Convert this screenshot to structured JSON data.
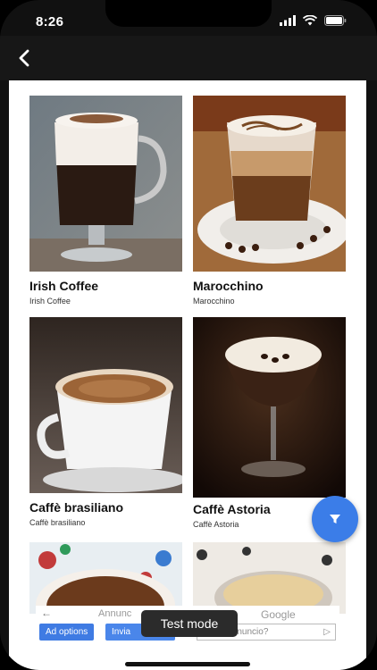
{
  "status_bar": {
    "time": "8:26"
  },
  "app_bar": {
    "back_icon": "chevron-left-icon"
  },
  "items": [
    {
      "title": "Irish Coffee",
      "subtitle": "Irish Coffee"
    },
    {
      "title": "Marocchino",
      "subtitle": "Marocchino"
    },
    {
      "title": "Caffè brasiliano",
      "subtitle": "Caffè brasiliano"
    },
    {
      "title": "Caffè Astoria",
      "subtitle": "Caffè Astoria"
    },
    {
      "title": "",
      "subtitle": ""
    },
    {
      "title": "",
      "subtitle": ""
    }
  ],
  "fab": {
    "icon": "filter-icon"
  },
  "ad": {
    "back_icon": "arrow-left-icon",
    "text_left": "Annunc",
    "text_right": "Google",
    "ad_options_label": "Ad options",
    "send_label": "Invia",
    "feedback_text": "uesto annuncio?",
    "feedback_icon": "play-icon"
  },
  "toast": {
    "text": "Test mode"
  },
  "colors": {
    "accent": "#3b7de8",
    "app_bar": "#171717"
  }
}
